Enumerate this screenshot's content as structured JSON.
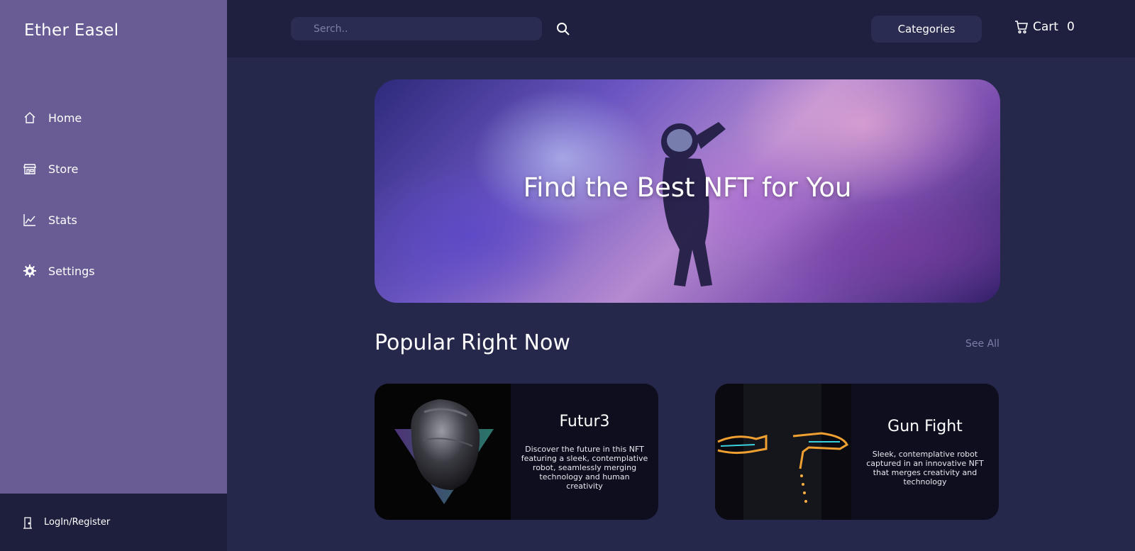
{
  "brand": "Ether Easel",
  "sidebar": {
    "items": [
      {
        "label": "Home",
        "icon": "home-icon"
      },
      {
        "label": "Store",
        "icon": "store-icon"
      },
      {
        "label": "Stats",
        "icon": "chart-icon"
      },
      {
        "label": "Settings",
        "icon": "gear-icon"
      }
    ],
    "login_label": "LogIn/Register"
  },
  "topbar": {
    "search_placeholder": "Serch..",
    "categories_label": "Categories",
    "cart_label": "Cart",
    "cart_count": "0"
  },
  "hero": {
    "title": "Find the Best NFT for You"
  },
  "popular": {
    "title": "Popular Right Now",
    "see_all": "See All",
    "cards": [
      {
        "name": "Futur3",
        "description": "Discover the future in this NFT featuring a sleek, contemplative robot, seamlessly merging technology and human creativity"
      },
      {
        "name": "Gun Fight",
        "description": "Sleek, contemplative robot captured in an innovative NFT that merges creativity and technology"
      }
    ]
  },
  "colors": {
    "sidebar": "#695b94",
    "background": "#25284b",
    "topbar": "#1f2040",
    "card": "#0e0e1e",
    "muted_text": "#7c7fa8"
  }
}
